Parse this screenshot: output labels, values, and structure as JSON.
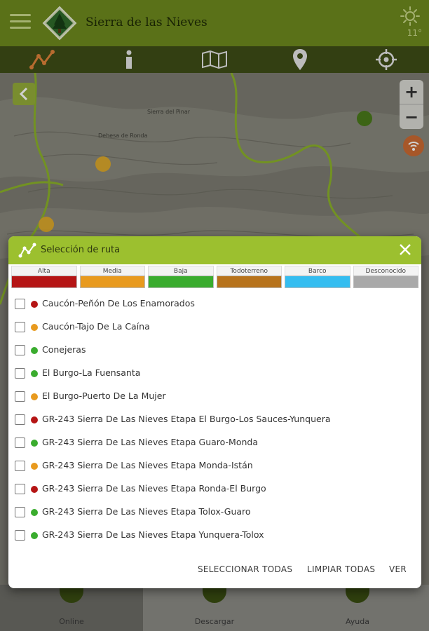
{
  "header": {
    "title": "Sierra de las Nieves",
    "temperature": "11°",
    "menu_icon": "hamburger-icon",
    "weather_icon": "sun-icon"
  },
  "toolbar": {
    "items": [
      {
        "icon": "route-icon"
      },
      {
        "icon": "info-icon"
      },
      {
        "icon": "map-layers-icon"
      },
      {
        "icon": "location-pin-icon"
      },
      {
        "icon": "gps-target-icon"
      }
    ]
  },
  "map": {
    "labels": [
      "Sierra del Pinar",
      "Dehesa de Ronda"
    ]
  },
  "dialog": {
    "title": "Selección de ruta",
    "close_icon": "close-icon",
    "legend": [
      {
        "label": "Alta",
        "color": "#b51515"
      },
      {
        "label": "Media",
        "color": "#e89a1e"
      },
      {
        "label": "Baja",
        "color": "#3aac2e"
      },
      {
        "label": "Todoterreno",
        "color": "#b7731c"
      },
      {
        "label": "Barco",
        "color": "#34bdf0"
      },
      {
        "label": "Desconocido",
        "color": "#a9a9a9"
      }
    ],
    "routes": [
      {
        "name": "Caucón-Peñón De Los Enamorados",
        "color": "#b51515"
      },
      {
        "name": "Caucón-Tajo De La Caína",
        "color": "#e89a1e"
      },
      {
        "name": "Conejeras",
        "color": "#3aac2e"
      },
      {
        "name": "El Burgo-La Fuensanta",
        "color": "#3aac2e"
      },
      {
        "name": "El Burgo-Puerto De La Mujer",
        "color": "#e89a1e"
      },
      {
        "name": "GR-243 Sierra De Las Nieves Etapa El Burgo-Los Sauces-Yunquera",
        "color": "#b51515"
      },
      {
        "name": "GR-243 Sierra De Las Nieves Etapa Guaro-Monda",
        "color": "#3aac2e"
      },
      {
        "name": "GR-243 Sierra De Las Nieves Etapa Monda-Istán",
        "color": "#e89a1e"
      },
      {
        "name": "GR-243 Sierra De Las Nieves Etapa Ronda-El Burgo",
        "color": "#b51515"
      },
      {
        "name": "GR-243 Sierra De Las Nieves Etapa Tolox-Guaro",
        "color": "#3aac2e"
      },
      {
        "name": "GR-243 Sierra De Las Nieves Etapa Yunquera-Tolox",
        "color": "#3aac2e"
      }
    ],
    "actions": {
      "select_all": "SELECCIONAR TODAS",
      "clear_all": "LIMPIAR TODAS",
      "view": "VER"
    }
  },
  "bottom_nav": {
    "items": [
      {
        "label": "Online",
        "icon": "wifi-icon"
      },
      {
        "label": "Descargar",
        "icon": "download-icon"
      },
      {
        "label": "Ayuda",
        "icon": "help-icon"
      }
    ]
  }
}
